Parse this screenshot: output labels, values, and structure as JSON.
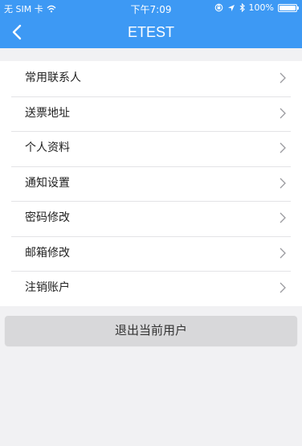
{
  "status_bar": {
    "carrier": "无 SIM 卡",
    "time": "下午7:09",
    "battery": "100%",
    "battery_level": 1.0,
    "icons": [
      "wifi-icon",
      "location-icon",
      "bluetooth-icon",
      "orientation-lock-icon",
      "battery-icon"
    ]
  },
  "nav": {
    "title": "ETEST",
    "back_icon": "chevron-left-icon"
  },
  "menu": {
    "items": [
      {
        "label": "常用联系人"
      },
      {
        "label": "送票地址"
      },
      {
        "label": "个人资料"
      },
      {
        "label": "通知设置"
      },
      {
        "label": "密码修改"
      },
      {
        "label": "邮箱修改"
      },
      {
        "label": "注销账户"
      }
    ],
    "chevron_icon": "chevron-right-icon"
  },
  "logout_button": {
    "label": "退出当前用户"
  },
  "colors": {
    "header_blue": "#3d99f4",
    "page_background": "#f1f1f3",
    "button_gray": "#d8d8da"
  }
}
